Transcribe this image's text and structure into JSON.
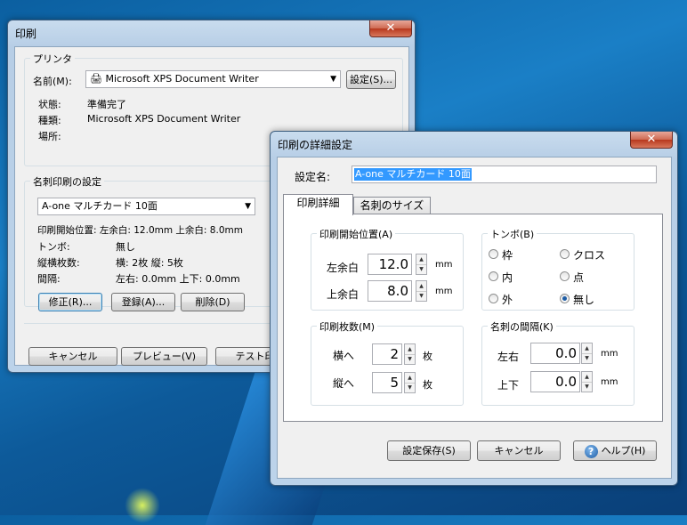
{
  "print_window": {
    "title": "印刷",
    "close": "✕",
    "printer_group": {
      "label": "プリンタ",
      "name_label": "名前(M):",
      "printer_name": "Microsoft XPS Document Writer",
      "settings_button": "設定(S)...",
      "status_label": "状態:",
      "status_value": "準備完了",
      "type_label": "種類:",
      "type_value": "Microsoft XPS Document Writer",
      "location_label": "場所:"
    },
    "card_group": {
      "label": "名刺印刷の設定",
      "selected_preset": "A-one マルチカード 10面",
      "start_pos_line": "印刷開始位置:  左余白: 12.0mm  上余白: 8.0mm",
      "tombo_label": "トンボ:",
      "tombo_value": "無し",
      "count_label": "縦横枚数:",
      "count_value": "横: 2枚  縦: 5枚",
      "gap_label": "間隔:",
      "gap_value": "左右: 0.0mm  上下: 0.0mm",
      "edit_button": "修正(R)...",
      "register_button": "登録(A)...",
      "delete_button": "削除(D)"
    },
    "footer": {
      "cancel_button": "キャンセル",
      "preview_button": "プレビュー(V)",
      "test_print_button": "テスト印刷"
    }
  },
  "detail_window": {
    "title": "印刷の詳細設定",
    "close": "✕",
    "setting_name_label": "設定名:",
    "setting_name_value": "A-one マルチカード 10面",
    "tabs": [
      "印刷詳細",
      "名刺のサイズ"
    ],
    "start_group": {
      "label": "印刷開始位置(A)",
      "left_label": "左余白",
      "left_value": "12.0",
      "top_label": "上余白",
      "top_value": "8.0",
      "unit": "mm"
    },
    "tombo_group": {
      "label": "トンボ(B)",
      "options": [
        "枠",
        "クロス",
        "内",
        "点",
        "外",
        "無し"
      ],
      "selected": "無し"
    },
    "count_group": {
      "label": "印刷枚数(M)",
      "horizontal_label": "横へ",
      "horizontal_value": "2",
      "vertical_label": "縦へ",
      "vertical_value": "5",
      "unit": "枚"
    },
    "gap_group": {
      "label": "名刺の間隔(K)",
      "lr_label": "左右",
      "lr_value": "0.0",
      "tb_label": "上下",
      "tb_value": "0.0",
      "unit": "mm"
    },
    "footer": {
      "save_button": "設定保存(S)",
      "cancel_button": "キャンセル",
      "help_button": "ヘルプ(H)"
    }
  }
}
